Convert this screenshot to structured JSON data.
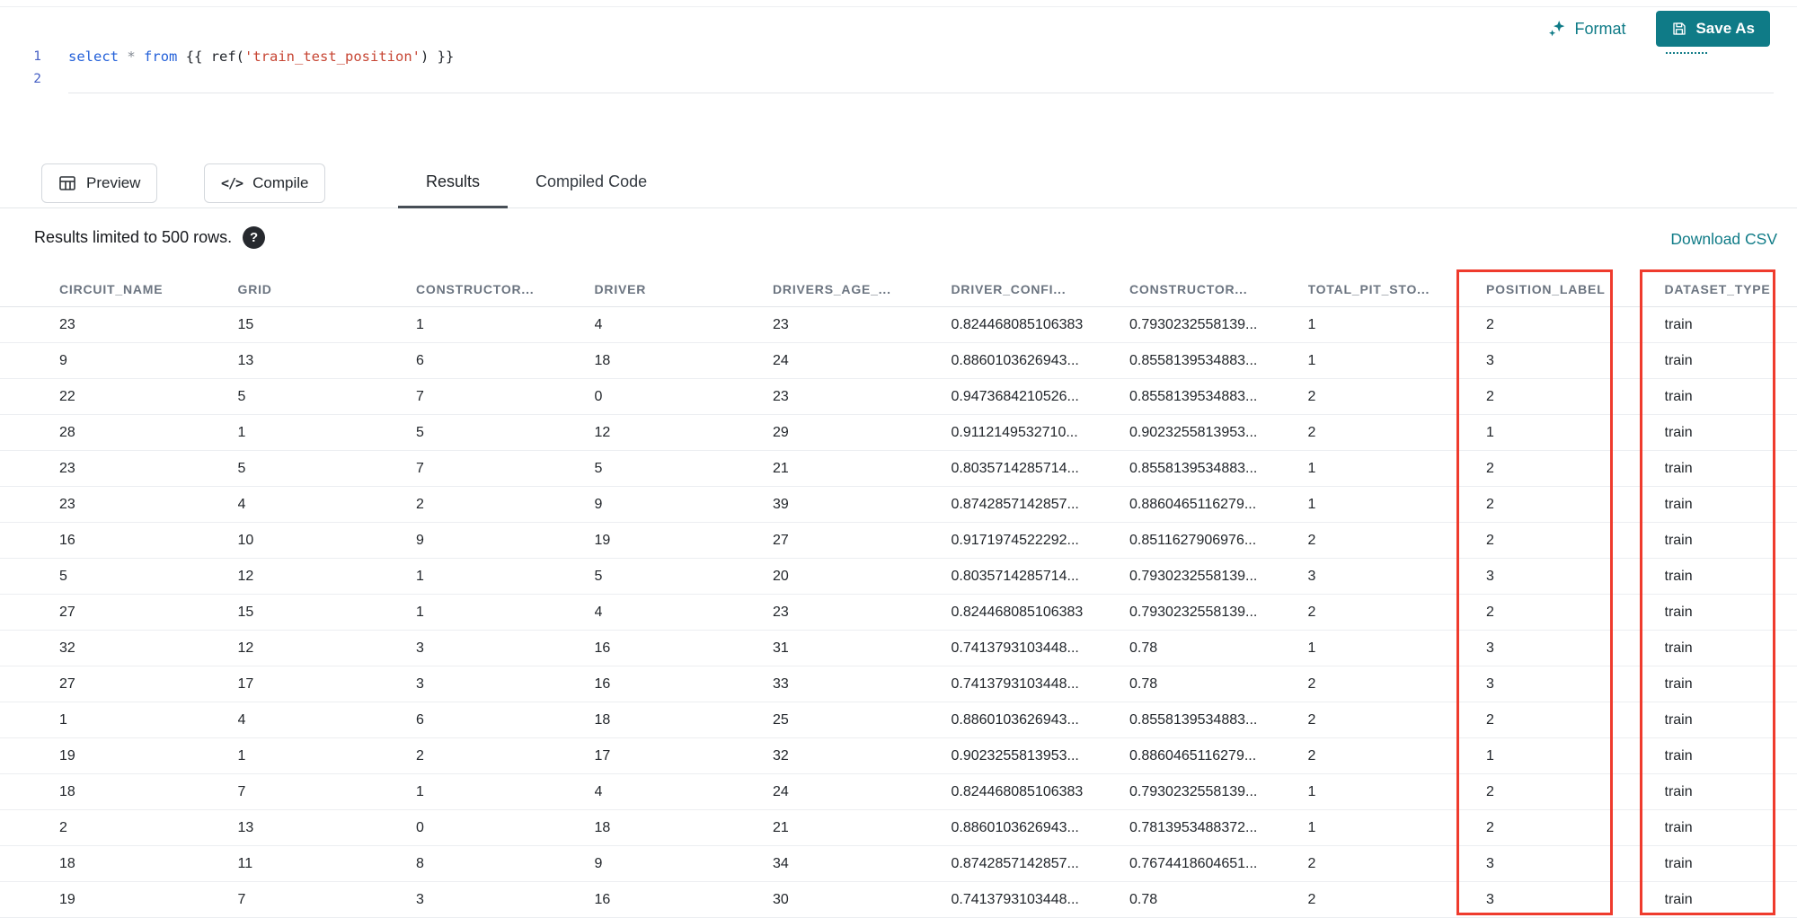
{
  "colors": {
    "accent": "#0f7b87",
    "keyword": "#2461d9",
    "string": "#c74634",
    "line-number": "#4660c4",
    "muted": "#6b7480",
    "highlight": "#ef3b2d"
  },
  "toolbar": {
    "format_label": "Format",
    "save_as_label": "Save As"
  },
  "editor": {
    "lines": [
      {
        "number": "1",
        "text": "select * from {{ ref('train_test_position') }}",
        "tokens": [
          {
            "t": "select",
            "c": "keyword"
          },
          {
            "t": " ",
            "c": "plain"
          },
          {
            "t": "*",
            "c": "operator"
          },
          {
            "t": " ",
            "c": "plain"
          },
          {
            "t": "from",
            "c": "keyword"
          },
          {
            "t": " {{ ",
            "c": "plain"
          },
          {
            "t": "ref(",
            "c": "plain"
          },
          {
            "t": "'train_test_position'",
            "c": "string"
          },
          {
            "t": ") }}",
            "c": "plain"
          }
        ]
      },
      {
        "number": "2",
        "text": "",
        "tokens": []
      }
    ]
  },
  "actions": {
    "preview_label": "Preview",
    "compile_label": "Compile",
    "compile_icon": "</>"
  },
  "tabs": [
    {
      "label": "Results",
      "active": true
    },
    {
      "label": "Compiled Code",
      "active": false
    }
  ],
  "status": {
    "message": "Results limited to 500 rows.",
    "help_icon": "?",
    "download_csv_label": "Download CSV"
  },
  "table": {
    "columns": [
      "CIRCUIT_NAME",
      "GRID",
      "CONSTRUCTOR...",
      "DRIVER",
      "DRIVERS_AGE_...",
      "DRIVER_CONFI...",
      "CONSTRUCTOR...",
      "TOTAL_PIT_STO...",
      "POSITION_LABEL",
      "DATASET_TYPE"
    ],
    "highlighted_columns": [
      "POSITION_LABEL",
      "DATASET_TYPE"
    ],
    "rows": [
      [
        "23",
        "15",
        "1",
        "4",
        "23",
        "0.824468085106383",
        "0.7930232558139...",
        "1",
        "2",
        "train"
      ],
      [
        "9",
        "13",
        "6",
        "18",
        "24",
        "0.8860103626943...",
        "0.8558139534883...",
        "1",
        "3",
        "train"
      ],
      [
        "22",
        "5",
        "7",
        "0",
        "23",
        "0.9473684210526...",
        "0.8558139534883...",
        "2",
        "2",
        "train"
      ],
      [
        "28",
        "1",
        "5",
        "12",
        "29",
        "0.9112149532710...",
        "0.9023255813953...",
        "2",
        "1",
        "train"
      ],
      [
        "23",
        "5",
        "7",
        "5",
        "21",
        "0.8035714285714...",
        "0.8558139534883...",
        "1",
        "2",
        "train"
      ],
      [
        "23",
        "4",
        "2",
        "9",
        "39",
        "0.8742857142857...",
        "0.8860465116279...",
        "1",
        "2",
        "train"
      ],
      [
        "16",
        "10",
        "9",
        "19",
        "27",
        "0.9171974522292...",
        "0.8511627906976...",
        "2",
        "2",
        "train"
      ],
      [
        "5",
        "12",
        "1",
        "5",
        "20",
        "0.8035714285714...",
        "0.7930232558139...",
        "3",
        "3",
        "train"
      ],
      [
        "27",
        "15",
        "1",
        "4",
        "23",
        "0.824468085106383",
        "0.7930232558139...",
        "2",
        "2",
        "train"
      ],
      [
        "32",
        "12",
        "3",
        "16",
        "31",
        "0.7413793103448...",
        "0.78",
        "1",
        "3",
        "train"
      ],
      [
        "27",
        "17",
        "3",
        "16",
        "33",
        "0.7413793103448...",
        "0.78",
        "2",
        "3",
        "train"
      ],
      [
        "1",
        "4",
        "6",
        "18",
        "25",
        "0.8860103626943...",
        "0.8558139534883...",
        "2",
        "2",
        "train"
      ],
      [
        "19",
        "1",
        "2",
        "17",
        "32",
        "0.9023255813953...",
        "0.8860465116279...",
        "2",
        "1",
        "train"
      ],
      [
        "18",
        "7",
        "1",
        "4",
        "24",
        "0.824468085106383",
        "0.7930232558139...",
        "1",
        "2",
        "train"
      ],
      [
        "2",
        "13",
        "0",
        "18",
        "21",
        "0.8860103626943...",
        "0.7813953488372...",
        "1",
        "2",
        "train"
      ],
      [
        "18",
        "11",
        "8",
        "9",
        "34",
        "0.8742857142857...",
        "0.7674418604651...",
        "2",
        "3",
        "train"
      ],
      [
        "19",
        "7",
        "3",
        "16",
        "30",
        "0.7413793103448...",
        "0.78",
        "2",
        "3",
        "train"
      ]
    ]
  }
}
